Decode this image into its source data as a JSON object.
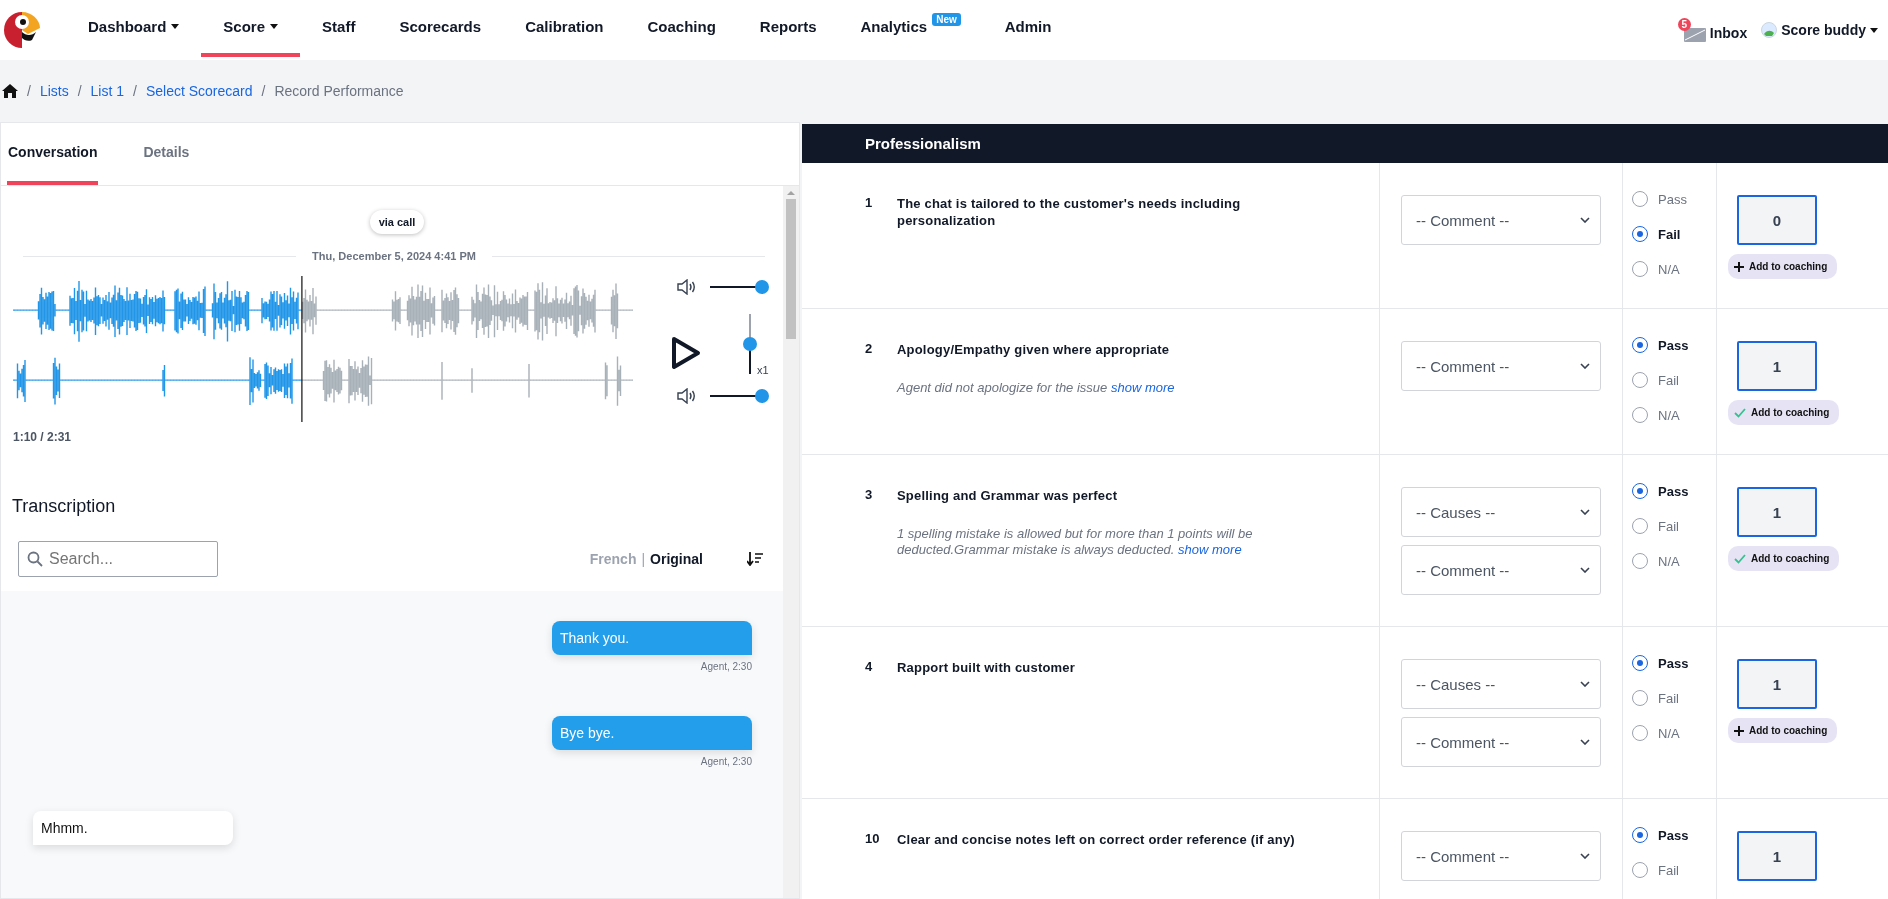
{
  "nav": {
    "items": [
      {
        "label": "Dashboard",
        "dropdown": true,
        "selected": false
      },
      {
        "label": "Score",
        "dropdown": true,
        "selected": true
      },
      {
        "label": "Staff",
        "dropdown": false,
        "selected": false
      },
      {
        "label": "Scorecards",
        "dropdown": false,
        "selected": false
      },
      {
        "label": "Calibration",
        "dropdown": false,
        "selected": false
      },
      {
        "label": "Coaching",
        "dropdown": false,
        "selected": false
      },
      {
        "label": "Reports",
        "dropdown": false,
        "selected": false
      },
      {
        "label": "Analytics",
        "dropdown": false,
        "selected": false,
        "badge": "New"
      },
      {
        "label": "Admin",
        "dropdown": false,
        "selected": false
      }
    ],
    "inbox": {
      "label": "Inbox",
      "count": "5"
    },
    "user": {
      "name": "Score buddy"
    }
  },
  "breadcrumb_separator": "/",
  "breadcrumb": [
    {
      "label": "Lists",
      "kind": "link"
    },
    {
      "label": "List 1",
      "kind": "link"
    },
    {
      "label": "Select Scorecard",
      "kind": "link"
    },
    {
      "label": "Record Performance",
      "kind": "current"
    }
  ],
  "left": {
    "tabs": [
      {
        "label": "Conversation",
        "selected": true
      },
      {
        "label": "Details",
        "selected": false
      }
    ],
    "channel": "via call",
    "date": "Thu, December 5, 2024 4:41 PM",
    "player": {
      "level": 0.465,
      "time": "1:10 / 2:31",
      "volumes": [
        {
          "level": 1
        },
        {
          "level": 1
        }
      ],
      "speed": {
        "level": 0.5,
        "reading": "x1"
      }
    },
    "transcription": {
      "title": "Transcription",
      "search": {
        "placeholder": "Search..."
      },
      "language_separator": "|",
      "languages": [
        {
          "label": "French",
          "selected": false
        },
        {
          "label": "Original",
          "selected": true
        }
      ],
      "messages": [
        {
          "text": "Thank you.",
          "meta": "Agent, 2:30",
          "kind": "agent"
        },
        {
          "text": "Bye bye.",
          "meta": "Agent, 2:30",
          "kind": "agent"
        },
        {
          "text": "Mhmm.",
          "kind": "customer"
        }
      ]
    }
  },
  "scorecard": {
    "section": "Professionalism",
    "rows": [
      {
        "number": "1",
        "question": "The chat is tailored to the customer's needs including personalization",
        "selects": [
          "-- Comment --"
        ],
        "options": [
          {
            "label": "Pass",
            "selected": false
          },
          {
            "label": "Fail",
            "selected": true
          },
          {
            "label": "N/A",
            "selected": false
          }
        ],
        "score": "0",
        "coaching": {
          "label": "Add to coaching",
          "added": false
        }
      },
      {
        "number": "2",
        "question": "Apology/Empathy given where appropriate",
        "note": "Agent did not apologize for the issue",
        "note_link": "show more",
        "selects": [
          "-- Comment --"
        ],
        "options": [
          {
            "label": "Pass",
            "selected": true
          },
          {
            "label": "Fail",
            "selected": false
          },
          {
            "label": "N/A",
            "selected": false
          }
        ],
        "score": "1",
        "coaching": {
          "label": "Add to coaching",
          "added": true
        }
      },
      {
        "number": "3",
        "question": "Spelling and Grammar was perfect",
        "note": "1 spelling mistake is allowed but for more than 1 points will be deducted.Grammar mistake is always deducted.",
        "note_link": "show more",
        "selects": [
          "-- Causes --",
          "-- Comment --"
        ],
        "options": [
          {
            "label": "Pass",
            "selected": true
          },
          {
            "label": "Fail",
            "selected": false
          },
          {
            "label": "N/A",
            "selected": false
          }
        ],
        "score": "1",
        "coaching": {
          "label": "Add to coaching",
          "added": true
        }
      },
      {
        "number": "4",
        "question": "Rapport built with customer",
        "selects": [
          "-- Causes --",
          "-- Comment --"
        ],
        "options": [
          {
            "label": "Pass",
            "selected": true
          },
          {
            "label": "Fail",
            "selected": false
          },
          {
            "label": "N/A",
            "selected": false
          }
        ],
        "score": "1",
        "coaching": {
          "label": "Add to coaching",
          "added": false
        }
      },
      {
        "number": "10",
        "question": "Clear and concise notes left on correct order reference (if any)",
        "selects": [
          "-- Comment --"
        ],
        "options": [
          {
            "label": "Pass",
            "selected": true
          },
          {
            "label": "Fail",
            "selected": false
          }
        ],
        "score": "1"
      }
    ]
  }
}
